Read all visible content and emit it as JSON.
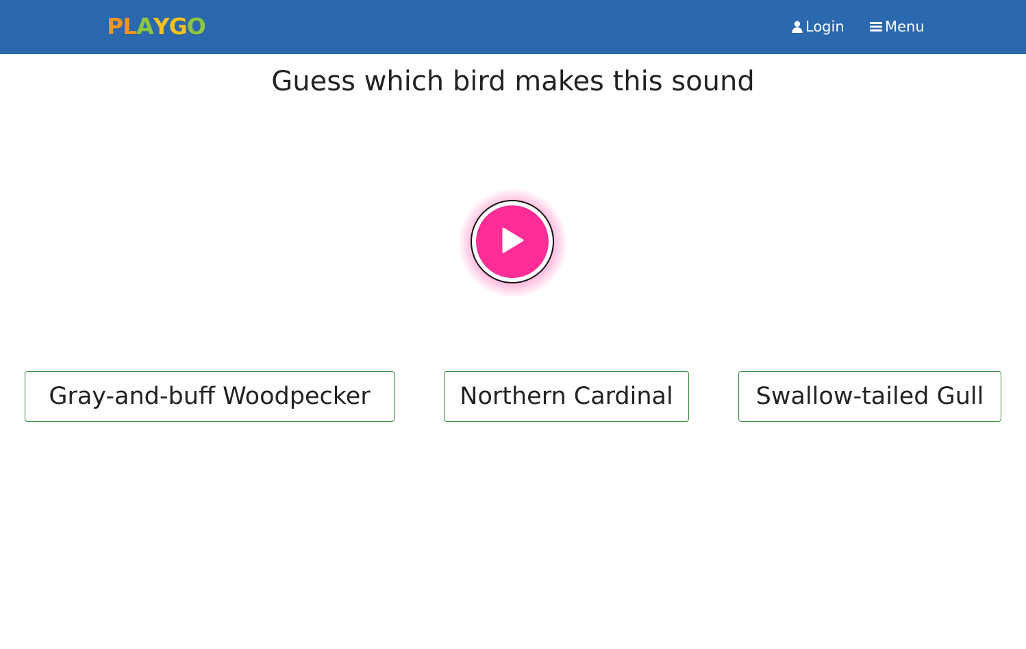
{
  "navbar": {
    "logo_letters": [
      {
        "char": "P",
        "color": "#f7941d"
      },
      {
        "char": "L",
        "color": "#f7941d"
      },
      {
        "char": "A",
        "color": "#8dc63f"
      },
      {
        "char": "Y",
        "color": "#f7c21d"
      },
      {
        "char": "G",
        "color": "#f7c21d"
      },
      {
        "char": "O",
        "color": "#8dc63f"
      }
    ],
    "login_label": "Login",
    "login_icon": "user-icon",
    "menu_label": "Menu",
    "menu_icon": "hamburger-icon",
    "background_color": "#2c68ae"
  },
  "main": {
    "title": "Guess which bird makes this sound",
    "play_button_icon": "play-icon",
    "play_button_color": "#ff2d95",
    "answers": [
      "Gray-and-buff Woodpecker",
      "Northern Cardinal",
      "Swallow-tailed Gull"
    ],
    "answer_border_color": "#2e8b3a"
  }
}
